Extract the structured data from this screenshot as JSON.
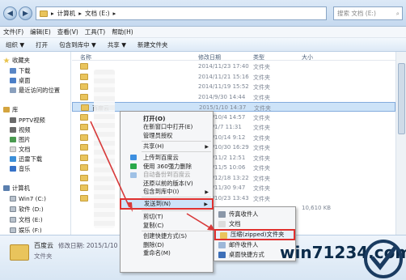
{
  "address": {
    "crumbs": [
      "计算机",
      "文档 (E:)"
    ],
    "search_placeholder": "搜索 文档 (E:)"
  },
  "menubar": [
    "文件(F)",
    "编辑(E)",
    "查看(V)",
    "工具(T)",
    "帮助(H)"
  ],
  "toolbar": [
    "组织 ▼",
    "打开",
    "包含到库中 ▼",
    "共享 ▼",
    "新建文件夹"
  ],
  "nav": {
    "favorites": "收藏夹",
    "downloads": "下载",
    "desktop": "桌面",
    "recent": "最近访问的位置",
    "library": "库",
    "pptv": "PPTV视频",
    "video": "视频",
    "pictures": "图片",
    "documents": "文档",
    "thunder": "迅雷下载",
    "music": "音乐",
    "computer": "计算机",
    "c": "Win7 (C:)",
    "d": "软件 (D:)",
    "e": "文档 (E:)",
    "f": "娱乐 (F:)"
  },
  "list": {
    "headers": [
      "名称",
      "修改日期",
      "类型",
      "大小"
    ],
    "rows": [
      {
        "name": "",
        "date": "2014/11/23 17:40",
        "type": "文件夹",
        "size": ""
      },
      {
        "name": "",
        "date": "2014/11/21 15:16",
        "type": "文件夹",
        "size": ""
      },
      {
        "name": "",
        "date": "2014/11/19 15:52",
        "type": "文件夹",
        "size": ""
      },
      {
        "name": "",
        "date": "2014/9/30 14:44",
        "type": "文件夹",
        "size": ""
      },
      {
        "name": "百度云",
        "date": "2015/1/10 14:37",
        "type": "文件夹",
        "size": ""
      },
      {
        "name": "",
        "date": "2014/10/4 14:57",
        "type": "文件夹",
        "size": ""
      },
      {
        "name": "",
        "date": "2015/1/7 11:31",
        "type": "文件夹",
        "size": ""
      },
      {
        "name": "",
        "date": "2014/10/14 9:12",
        "type": "文件夹",
        "size": ""
      },
      {
        "name": "",
        "date": "2014/10/30 16:29",
        "type": "文件夹",
        "size": ""
      },
      {
        "name": "",
        "date": "2014/11/2 12:51",
        "type": "文件夹",
        "size": ""
      },
      {
        "name": "",
        "date": "2014/11/5 10:06",
        "type": "文件夹",
        "size": ""
      },
      {
        "name": "",
        "date": "2014/12/18 13:22",
        "type": "文件夹",
        "size": ""
      },
      {
        "name": "",
        "date": "2014/11/30 9:47",
        "type": "文件夹",
        "size": ""
      },
      {
        "name": "",
        "date": "2014/10/23 13:43",
        "type": "文件夹",
        "size": ""
      },
      {
        "name": "",
        "date": "",
        "type": "",
        "size": "10,610 KB"
      }
    ]
  },
  "details": {
    "name": "百度云",
    "modified": "修改日期: 2015/1/10 14:37",
    "type": "文件夹"
  },
  "context_menu": [
    {
      "label": "打开(O)",
      "bold": true
    },
    {
      "label": "在新窗口中打开(E)"
    },
    {
      "label": "管理员授权"
    },
    {
      "sep": true
    },
    {
      "label": "共享(H)",
      "sub": true
    },
    {
      "sep": true
    },
    {
      "label": "上传到百度云"
    },
    {
      "label": "使用 360强力删除"
    },
    {
      "label": "自动备份到百度云",
      "dim": true
    },
    {
      "label": "还原以前的版本(V)"
    },
    {
      "label": "包含到库中(I)",
      "sub": true
    },
    {
      "sep": true
    },
    {
      "label": "发送到(N)",
      "sub": true,
      "highlight": true
    },
    {
      "sep": true
    },
    {
      "label": "剪切(T)"
    },
    {
      "label": "复制(C)"
    },
    {
      "sep": true
    },
    {
      "label": "创建快捷方式(S)"
    },
    {
      "label": "删除(D)"
    },
    {
      "label": "重命名(M)"
    }
  ],
  "sendto": [
    {
      "label": "传真收件人"
    },
    {
      "label": "文档"
    },
    {
      "label": "压缩(zipped)文件夹",
      "highlight": true
    },
    {
      "label": "邮件收件人"
    },
    {
      "label": "桌面快捷方式"
    }
  ],
  "watermark": "win71234.com",
  "colors": {
    "highlight_border": "#e0312f",
    "selection": "#cde3f8",
    "arrow": "#d83a3a"
  }
}
